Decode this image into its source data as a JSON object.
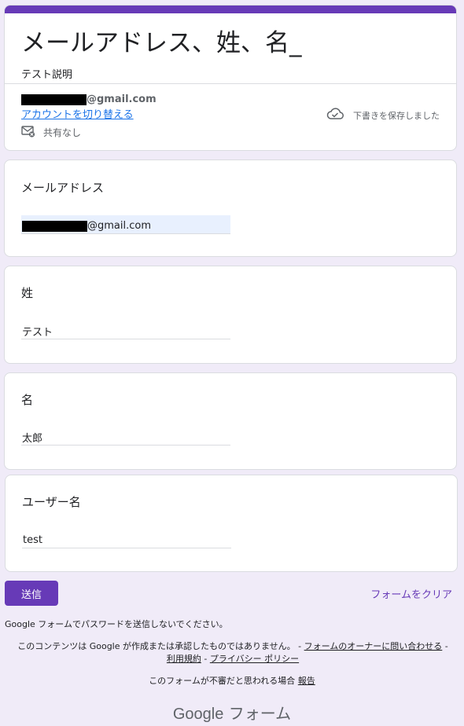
{
  "form": {
    "title": "メールアドレス、姓、名_",
    "description": "テスト説明"
  },
  "account": {
    "email_suffix": "@gmail.com",
    "switch_link": "アカウントを切り替える",
    "share_text": "共有なし",
    "saved_text": "下書きを保存しました"
  },
  "questions": [
    {
      "label": "メールアドレス",
      "value_suffix": "@gmail.com"
    },
    {
      "label": "姓",
      "value": "テスト"
    },
    {
      "label": "名",
      "value": "太郎"
    },
    {
      "label": "ユーザー名",
      "value": "test"
    }
  ],
  "footer": {
    "submit": "送信",
    "clear": "フォームをクリア",
    "password_note": "Google フォームでパスワードを送信しないでください。",
    "disclaimer_text": "このコンテンツは Google が作成または承認したものではありません。 - ",
    "contact_owner": "フォームのオーナーに問い合わせる",
    "sep1": " - ",
    "terms": "利用規約",
    "sep2": " - ",
    "privacy": "プライバシー ポリシー",
    "report_prefix": "このフォームが不審だと思われる場合 ",
    "report_link": "報告",
    "brand_google": "Google",
    "brand_forms": " フォーム"
  },
  "colors": {
    "accent": "#673ab7",
    "background": "#f0ebf8",
    "link": "#1a73e8",
    "autofill": "#e8f0fe"
  },
  "icons": [
    "mail-no-share-icon",
    "cloud-saved-icon"
  ]
}
